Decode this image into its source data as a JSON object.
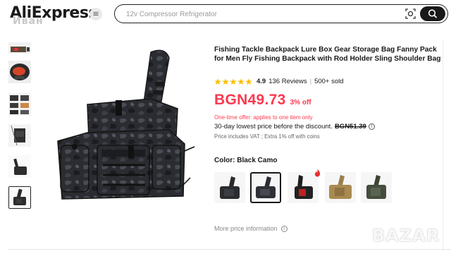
{
  "header": {
    "logo_text": "AliExpress",
    "logo_watermark": "Иван",
    "menu_icon": "hamburger-icon",
    "search_placeholder": "12v Compressor Refrigerator",
    "camera_icon": "camera-search-icon",
    "search_icon": "search-icon"
  },
  "gallery": {
    "thumbnails": [
      "thumb-1",
      "thumb-2",
      "thumb-3",
      "thumb-4",
      "thumb-5",
      "thumb-6"
    ],
    "selected_index": 5
  },
  "product": {
    "title": "Fishing Tackle Backpack Lure Box Gear Storage Bag Fanny Pack for Men Fly Fishing Backpack with Rod Holder Sling Shoulder Bag",
    "rating": "4.9",
    "stars": 5,
    "reviews": "136 Reviews",
    "separator": "|",
    "sold": "500+ sold",
    "price": "BGN49.73",
    "discount": "3% off",
    "offer_note": "One-time offer: applies to one item only",
    "lowest_text": "30-day lowest price before the discount.",
    "lowest_price": "BGN51.39",
    "vat_note": "Price includes VAT ; Extra 1% off with coins",
    "color_label": "Color: Black Camo",
    "swatches": [
      "Black Camo",
      "Black Camo",
      "Black Camo",
      "Khaki",
      "Camo Green"
    ],
    "selected_swatch": 1,
    "more_price": "More price information"
  },
  "watermark": "BAZAR",
  "colors": {
    "accent_red": "#fd384f",
    "text_dark": "#191919",
    "star_yellow": "#fdc000",
    "muted": "#888888"
  }
}
